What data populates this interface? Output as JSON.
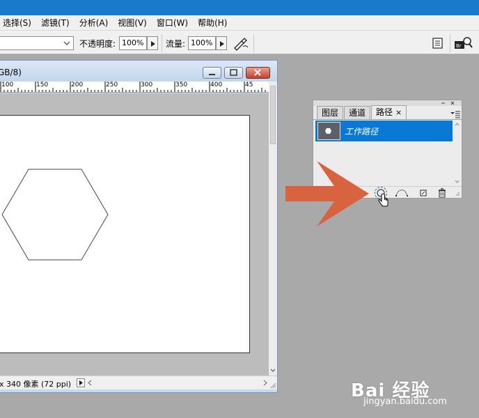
{
  "menubar": {
    "items": [
      "选择(S)",
      "滤镜(T)",
      "分析(A)",
      "视图(V)",
      "窗口(W)",
      "帮助(H)"
    ]
  },
  "options": {
    "opacity_label": "不透明度:",
    "opacity_value": "100%",
    "flow_label": "流量:",
    "flow_value": "100%"
  },
  "document": {
    "title": "GB/8)",
    "ruler_labels": [
      "100",
      "150",
      "200",
      "250",
      "300",
      "350",
      "400",
      "45"
    ],
    "status": "x 340 像素 (72 ppi)"
  },
  "panel": {
    "tabs": [
      "图层",
      "通道",
      "路径"
    ],
    "tab_close": "×",
    "path_name": "工作路径"
  },
  "overlay": {
    "arrow_color": "#d9623f"
  },
  "watermark": {
    "brand": "Bai 经验",
    "url": "jingyan.baidu.com"
  },
  "colors": {
    "workspace": "#a9a9a9",
    "title_blue": "#1979ca",
    "selection_blue": "#0a79d6"
  }
}
